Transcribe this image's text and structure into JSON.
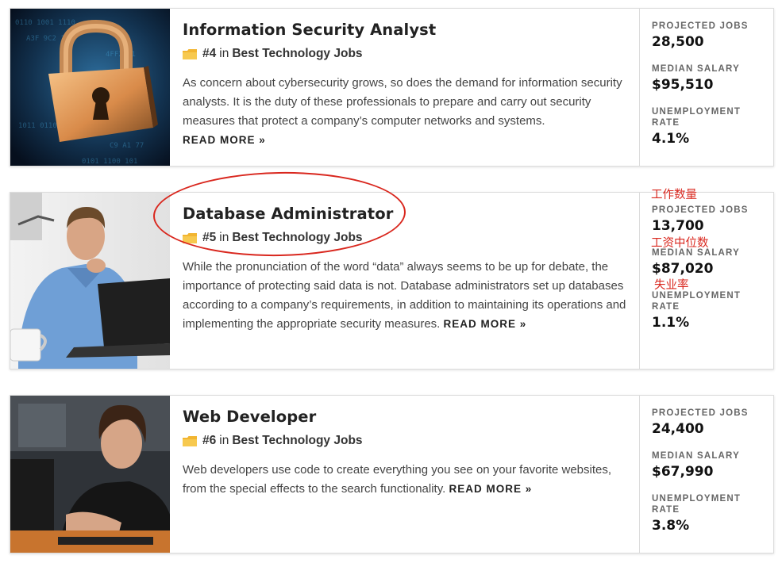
{
  "jobs": [
    {
      "title": "Information Security Analyst",
      "rank": "#4",
      "rank_in": "in",
      "category": "Best Technology Jobs",
      "description": "As concern about cybersecurity grows, so does the demand for information security analysts. It is the duty of these professionals to prepare and carry out security measures that protect a company’s computer networks and systems.",
      "read_more": "READ MORE »",
      "projected_jobs_label": "PROJECTED JOBS",
      "projected_jobs": "28,500",
      "median_salary_label": "MEDIAN SALARY",
      "median_salary": "$95,510",
      "unemployment_label": "UNEMPLOYMENT RATE",
      "unemployment_rate": "4.1%"
    },
    {
      "title": "Database Administrator",
      "rank": "#5",
      "rank_in": "in",
      "category": "Best Technology Jobs",
      "description": "While the pronunciation of the word “data” always seems to be up for debate, the importance of protecting said data is not. Database administrators set up databases according to a company’s requirements, in addition to maintaining its operations and implementing the appropriate security measures.",
      "read_more": "READ MORE »",
      "projected_jobs_label": "PROJECTED JOBS",
      "projected_jobs": "13,700",
      "median_salary_label": "MEDIAN SALARY",
      "median_salary": "$87,020",
      "unemployment_label": "UNEMPLOYMENT RATE",
      "unemployment_rate": "1.1%"
    },
    {
      "title": "Web Developer",
      "rank": "#6",
      "rank_in": "in",
      "category": "Best Technology Jobs",
      "description": "Web developers use code to create everything you see on your favorite websites, from the special effects to the search functionality.",
      "read_more": "READ MORE »",
      "projected_jobs_label": "PROJECTED JOBS",
      "projected_jobs": "24,400",
      "median_salary_label": "MEDIAN SALARY",
      "median_salary": "$67,990",
      "unemployment_label": "UNEMPLOYMENT RATE",
      "unemployment_rate": "3.8%"
    }
  ],
  "annotations": {
    "projected_jobs": "工作数量",
    "median_salary": "工资中位数",
    "unemployment_rate": "失业率"
  },
  "colors": {
    "annotation": "#d9271e",
    "folder_icon": "#f2b531",
    "border": "#dcdcdc"
  },
  "icons": {
    "rank_icon": "folder-icon",
    "card1_image": "padlock-image",
    "card2_image": "man-at-laptop-image",
    "card3_image": "young-man-at-computer-image"
  }
}
